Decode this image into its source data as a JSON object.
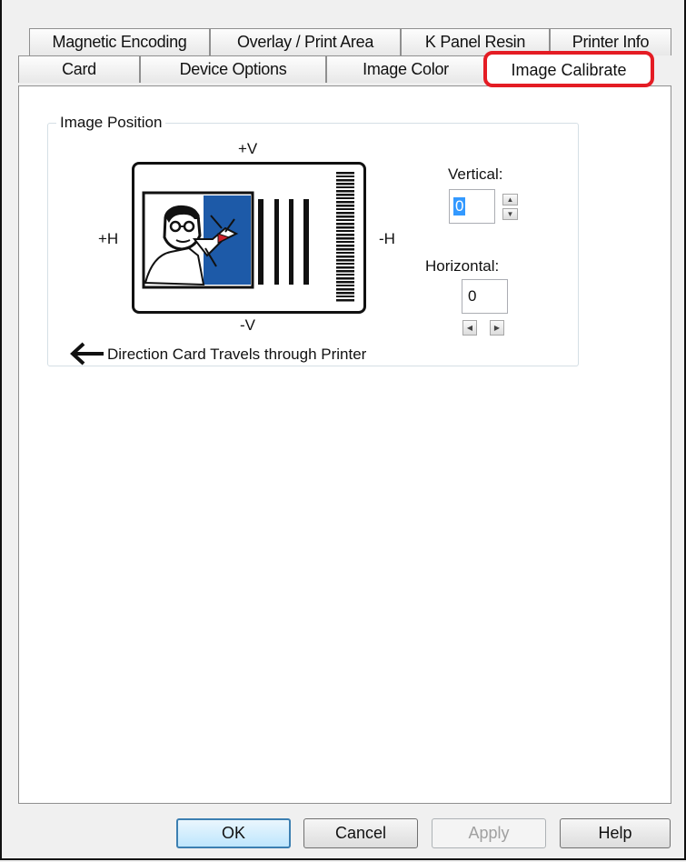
{
  "tabs_back": [
    "Magnetic Encoding",
    "Overlay / Print Area",
    "K Panel Resin",
    "Printer Info"
  ],
  "tabs_front": [
    "Card",
    "Device Options",
    "Image Color"
  ],
  "active_tab": "Image Calibrate",
  "highlight_color": "#e41c24",
  "group": {
    "title": "Image Position",
    "plus_v": "+V",
    "minus_v": "-V",
    "plus_h": "+H",
    "minus_h": "-H",
    "direction_text": "Direction Card Travels through Printer",
    "arrow_icon": "left-arrow-icon"
  },
  "vertical": {
    "label": "Vertical:",
    "value": "0"
  },
  "horizontal": {
    "label": "Horizontal:",
    "value": "0"
  },
  "buttons": {
    "ok": "OK",
    "cancel": "Cancel",
    "apply": "Apply",
    "help": "Help"
  },
  "colors": {
    "suit_blue": "#1d5aa8",
    "tie_red": "#d0202a"
  }
}
